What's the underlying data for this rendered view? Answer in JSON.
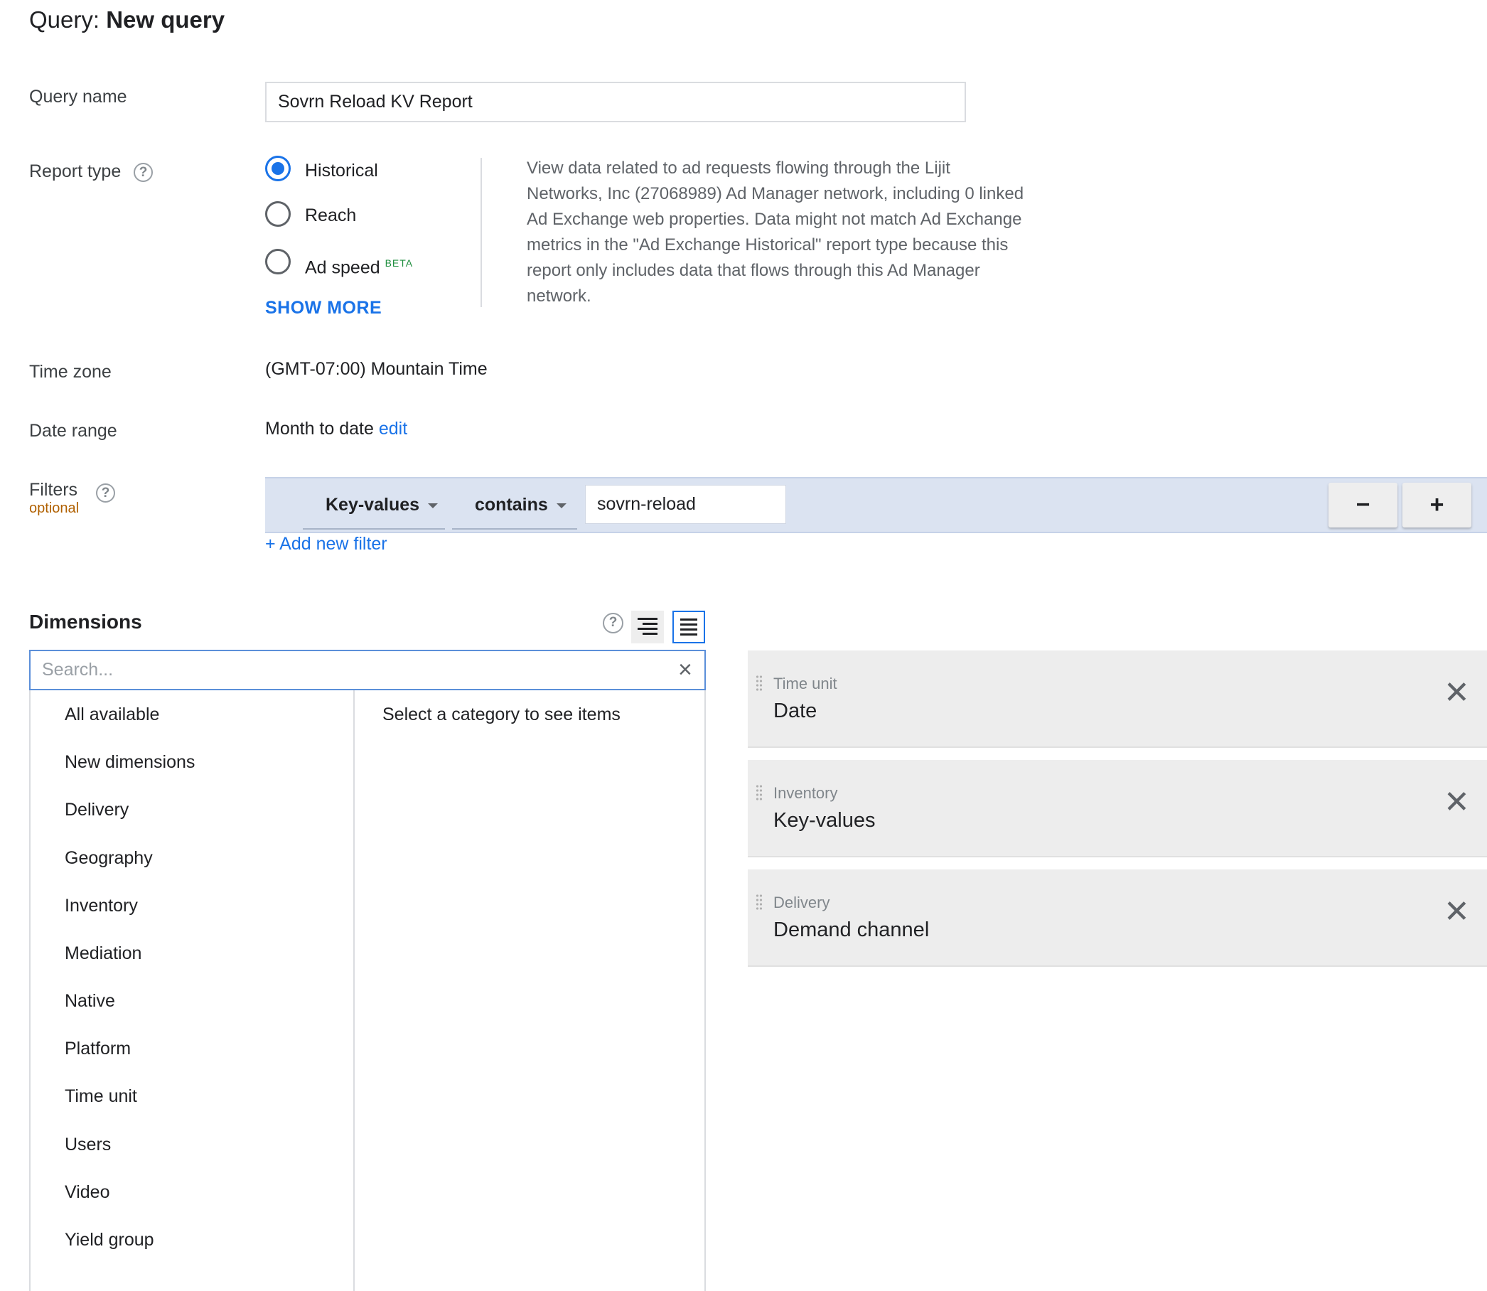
{
  "header": {
    "prefix": "Query: ",
    "title": "New query"
  },
  "query_name": {
    "label": "Query name",
    "value": "Sovrn Reload KV Report"
  },
  "report_type": {
    "label": "Report type",
    "options": [
      {
        "label": "Historical",
        "checked": true
      },
      {
        "label": "Reach",
        "checked": false
      },
      {
        "label": "Ad speed",
        "badge": "BETA",
        "checked": false
      }
    ],
    "show_more": "SHOW MORE",
    "description": "View data related to ad requests flowing through the Lijit Networks, Inc (27068989) Ad Manager network, including 0 linked Ad Exchange web properties. Data might not match Ad Exchange metrics in the \"Ad Exchange Historical\" report type because this report only includes data that flows through this Ad Manager network."
  },
  "time_zone": {
    "label": "Time zone",
    "value": "(GMT-07:00) Mountain Time"
  },
  "date_range": {
    "label": "Date range",
    "value": "Month to date",
    "edit": "edit"
  },
  "filters": {
    "label": "Filters",
    "optional": "optional",
    "field": "Key-values",
    "operator": "contains",
    "value": "sovrn-reload",
    "remove_label": "−",
    "add_label": "+",
    "add_new": "+ Add new filter"
  },
  "dimensions": {
    "title": "Dimensions",
    "search_placeholder": "Search...",
    "categories": [
      "All available",
      "New dimensions",
      "Delivery",
      "Geography",
      "Inventory",
      "Mediation",
      "Native",
      "Platform",
      "Time unit",
      "Users",
      "Video",
      "Yield group"
    ],
    "hint": "Select a category to see items",
    "selected": [
      {
        "category": "Time unit",
        "name": "Date"
      },
      {
        "category": "Inventory",
        "name": "Key-values"
      },
      {
        "category": "Delivery",
        "name": "Demand channel"
      }
    ]
  },
  "colors": {
    "accent": "#1a73e8",
    "filter_bg": "#dbe3f1",
    "optional": "#b06000",
    "chip_bg": "#ededed"
  }
}
